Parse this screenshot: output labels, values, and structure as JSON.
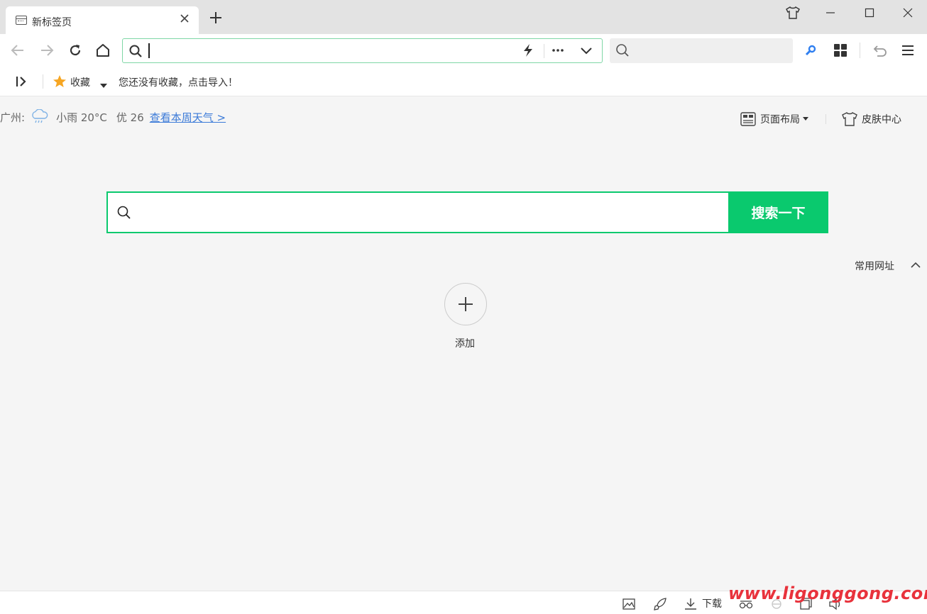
{
  "tab": {
    "title": "新标签页"
  },
  "toolbar": {
    "url_value": "",
    "search_placeholder": ""
  },
  "bookmarks": {
    "favorites_label": "收藏",
    "hint": "您还没有收藏，点击导入！"
  },
  "weather": {
    "city": "广州:",
    "condition_temp": "小雨 20°C",
    "aqi": "优 26",
    "link": "查看本周天气 >"
  },
  "page_controls": {
    "layout_label": "页面布局",
    "skin_label": "皮肤中心"
  },
  "main_search": {
    "button_label": "搜索一下",
    "placeholder": ""
  },
  "frequent_sites": {
    "section_label": "常用网址",
    "add_label": "添加"
  },
  "statusbar": {
    "download_label": "下载"
  },
  "watermark": "www.ligonggong.com",
  "colors": {
    "accent_green": "#0ac96e",
    "link_blue": "#3b7ad8",
    "star_orange": "#f6a623",
    "watermark_red": "#e8323c"
  },
  "icons": [
    "tab-page-icon",
    "close-icon",
    "plus-icon",
    "skin-shirt-icon",
    "minimize-icon",
    "maximize-icon",
    "window-close-icon",
    "back-arrow-icon",
    "forward-arrow-icon",
    "reload-icon",
    "home-icon",
    "search-icon",
    "lightning-icon",
    "more-dots-icon",
    "chevron-down-icon",
    "key-search-icon",
    "apps-grid-icon",
    "undo-icon",
    "menu-icon",
    "sidebar-toggle-icon",
    "star-icon",
    "dropdown-triangle-icon",
    "rain-cloud-icon",
    "layout-icon",
    "chevron-up-icon",
    "image-icon",
    "rocket-icon",
    "download-icon",
    "glasses-icon",
    "ie-icon",
    "window-icon",
    "speaker-icon"
  ]
}
